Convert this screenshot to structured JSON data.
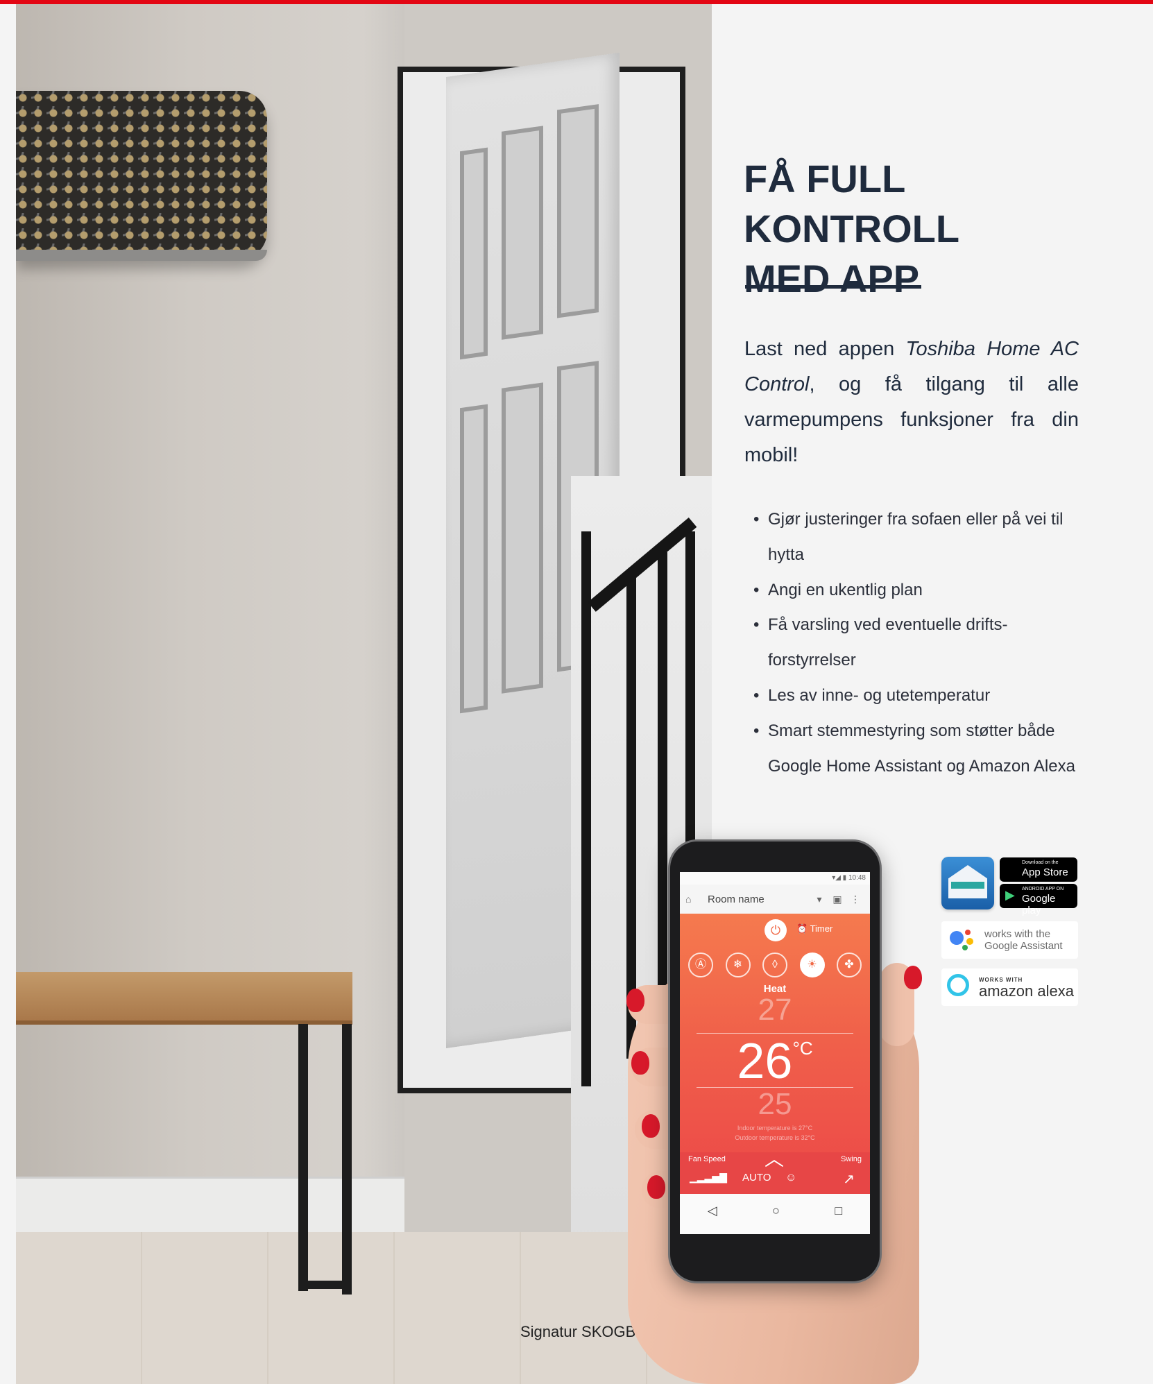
{
  "heading": {
    "line1": "FÅ FULL KONTROLL",
    "line2": "MED APP"
  },
  "intro": {
    "part1": "Last ned appen ",
    "app_name": "Toshiba Home AC Control",
    "part2": ", og få tilgang til alle varmepumpens funksjoner fra din mobil!"
  },
  "bullets": [
    "Gjør justeringer fra sofaen eller på vei til hytta",
    "Angi en ukentlig plan",
    "Få varsling ved eventuelle drifts-forstyrrelser",
    "Les av inne- og utetemperatur",
    "Smart stemmestyring som støtter både Google Home Assistant og Amazon Alexa"
  ],
  "photo_caption": "Signatur SKOGBUNN",
  "badges": {
    "app_store_small": "Download on the",
    "app_store_big": "App Store",
    "google_play_small": "ANDROID APP ON",
    "google_play_big": "Google play",
    "google_assistant": "works with the Google Assistant",
    "alexa_small": "WORKS WITH",
    "alexa_big": "amazon alexa"
  },
  "phone_app": {
    "clock": "10:48",
    "room_name": "Room name",
    "timer_label": "Timer",
    "mode_label": "Heat",
    "temp_above": "27",
    "temp_current": "26",
    "temp_unit": "°C",
    "temp_below": "25",
    "indoor_info": "Indoor temperature is 27°C",
    "outdoor_info": "Outdoor temperature is 32°C",
    "fan_speed_label": "Fan Speed",
    "fan_speed_value": "AUTO",
    "swing_label": "Swing"
  },
  "colors": {
    "accent_red": "#e30613",
    "heading_navy": "#1f2b3d",
    "app_orange": "#f06a48"
  }
}
